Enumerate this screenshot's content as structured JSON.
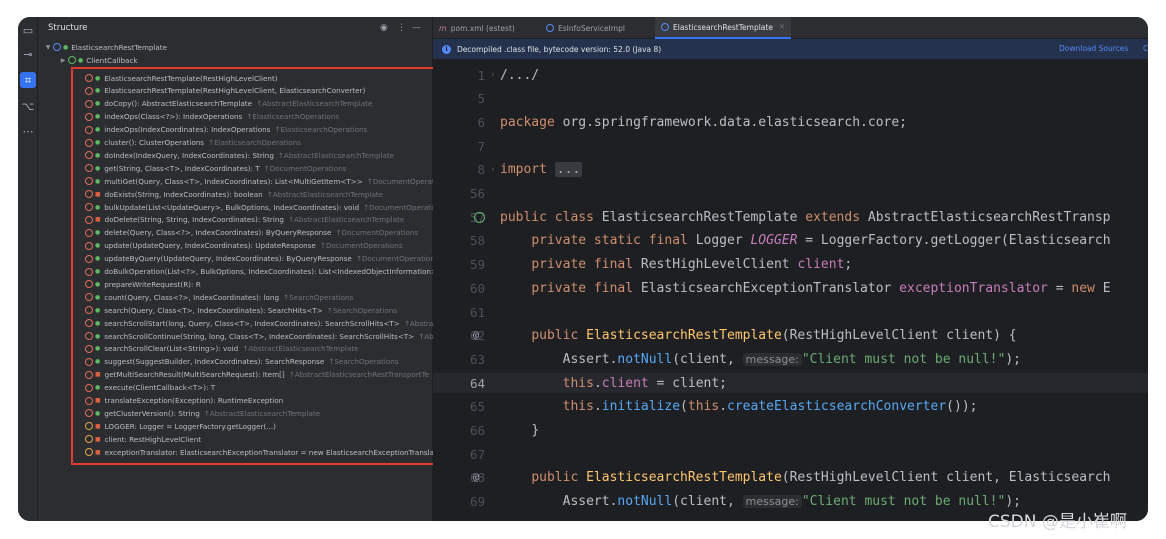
{
  "structure": {
    "title": "Structure",
    "root_label": "ElasticsearchRestTemplate",
    "child_label": "ClientCallback",
    "members": [
      {
        "sig": "ElasticsearchRestTemplate(RestHighLevelClient)",
        "parent": "",
        "kind": "method",
        "vis": "public"
      },
      {
        "sig": "ElasticsearchRestTemplate(RestHighLevelClient, ElasticsearchConverter)",
        "parent": "",
        "kind": "method",
        "vis": "public"
      },
      {
        "sig": "doCopy(): AbstractElasticsearchTemplate",
        "parent": "↑AbstractElasticsearchTemplate",
        "kind": "method",
        "vis": "public"
      },
      {
        "sig": "indexOps(Class<?>): IndexOperations",
        "parent": "↑ElasticsearchOperations",
        "kind": "method",
        "vis": "public"
      },
      {
        "sig": "indexOps(IndexCoordinates): IndexOperations",
        "parent": "↑ElasticsearchOperations",
        "kind": "method",
        "vis": "public"
      },
      {
        "sig": "cluster(): ClusterOperations",
        "parent": "↑ElasticsearchOperations",
        "kind": "method",
        "vis": "public"
      },
      {
        "sig": "doIndex(IndexQuery, IndexCoordinates): String",
        "parent": "↑AbstractElasticsearchTemplate",
        "kind": "method",
        "vis": "public"
      },
      {
        "sig": "get(String, Class<T>, IndexCoordinates): T",
        "parent": "↑DocumentOperations",
        "kind": "method",
        "vis": "public"
      },
      {
        "sig": "multiGet(Query, Class<T>, IndexCoordinates): List<MultiGetItem<T>>",
        "parent": "↑DocumentOperatio",
        "kind": "method",
        "vis": "public"
      },
      {
        "sig": "doExists(String, IndexCoordinates): boolean",
        "parent": "↑AbstractElasticsearchTemplate",
        "kind": "method",
        "vis": "protected"
      },
      {
        "sig": "bulkUpdate(List<UpdateQuery>, BulkOptions, IndexCoordinates): void",
        "parent": "↑DocumentOperati",
        "kind": "method",
        "vis": "public"
      },
      {
        "sig": "doDelete(String, String, IndexCoordinates): String",
        "parent": "↑AbstractElasticsearchTemplate",
        "kind": "method",
        "vis": "protected"
      },
      {
        "sig": "delete(Query, Class<?>, IndexCoordinates): ByQueryResponse",
        "parent": "↑DocumentOperations",
        "kind": "method",
        "vis": "public"
      },
      {
        "sig": "update(UpdateQuery, IndexCoordinates): UpdateResponse",
        "parent": "↑DocumentOperations",
        "kind": "method",
        "vis": "public"
      },
      {
        "sig": "updateByQuery(UpdateQuery, IndexCoordinates): ByQueryResponse",
        "parent": "↑DocumentOperation",
        "kind": "method",
        "vis": "public"
      },
      {
        "sig": "doBulkOperation(List<?>, BulkOptions, IndexCoordinates): List<IndexedObjectInformation>",
        "parent": "",
        "kind": "method",
        "vis": "public"
      },
      {
        "sig": "prepareWriteRequest(R): R",
        "parent": "",
        "kind": "method",
        "vis": "public"
      },
      {
        "sig": "count(Query, Class<?>, IndexCoordinates): long",
        "parent": "↑SearchOperations",
        "kind": "method",
        "vis": "public"
      },
      {
        "sig": "search(Query, Class<T>, IndexCoordinates): SearchHits<T>",
        "parent": "↑SearchOperations",
        "kind": "method",
        "vis": "public"
      },
      {
        "sig": "searchScrollStart(long, Query, Class<T>, IndexCoordinates): SearchScrollHits<T>",
        "parent": "↑Abstra",
        "kind": "method",
        "vis": "public"
      },
      {
        "sig": "searchScrollContinue(String, long, Class<T>, IndexCoordinates): SearchScrollHits<T>",
        "parent": "↑Ab",
        "kind": "method",
        "vis": "public"
      },
      {
        "sig": "searchScrollClear(List<String>): void",
        "parent": "↑AbstractElasticsearchTemplate",
        "kind": "method",
        "vis": "public"
      },
      {
        "sig": "suggest(SuggestBuilder, IndexCoordinates): SearchResponse",
        "parent": "↑SearchOperations",
        "kind": "method",
        "vis": "public"
      },
      {
        "sig": "getMultiSearchResult(MultiSearchRequest): Item[]",
        "parent": "↑AbstractElasticsearchRestTransportTe",
        "kind": "method",
        "vis": "protected"
      },
      {
        "sig": "execute(ClientCallback<T>): T",
        "parent": "",
        "kind": "method",
        "vis": "public"
      },
      {
        "sig": "translateException(Exception): RuntimeException",
        "parent": "",
        "kind": "method",
        "vis": "private"
      },
      {
        "sig": "getClusterVersion(): String",
        "parent": "↑AbstractElasticsearchTemplate",
        "kind": "method",
        "vis": "public"
      },
      {
        "sig": "LOGGER: Logger = LoggerFactory.getLogger(...)",
        "parent": "",
        "kind": "field",
        "vis": "private"
      },
      {
        "sig": "client: RestHighLevelClient",
        "parent": "",
        "kind": "field",
        "vis": "private"
      },
      {
        "sig": "exceptionTranslator: ElasticsearchExceptionTranslator = new ElasticsearchExceptionTransla",
        "parent": "",
        "kind": "field",
        "vis": "private"
      }
    ]
  },
  "tabs": [
    {
      "label": "pom.xml (estest)",
      "icon": "m"
    },
    {
      "label": "EsInfoServiceImpl",
      "icon": "class"
    },
    {
      "label": "ElasticsearchRestTemplate",
      "icon": "class",
      "active": true
    }
  ],
  "banner": {
    "text": "Decompiled .class file, bytecode version: 52.0 (Java 8)",
    "download": "Download Sources",
    "choose": "C"
  },
  "code": {
    "lines": [
      {
        "n": "1",
        "kind": "fold-comment",
        "text": "/.../"
      },
      {
        "n": "5",
        "kind": "blank"
      },
      {
        "n": "6",
        "kind": "package",
        "kw": "package",
        "rest": "org.springframework.data.elasticsearch.core;"
      },
      {
        "n": "7",
        "kind": "blank"
      },
      {
        "n": "8",
        "kind": "import",
        "kw": "import",
        "fold": "..."
      },
      {
        "n": "56",
        "kind": "blank"
      },
      {
        "n": "57",
        "kind": "classdecl",
        "p1": "public class ",
        "name": "ElasticsearchRestTemplate ",
        "p2": "extends ",
        "rest": "AbstractElasticsearchRestTransp"
      },
      {
        "n": "58",
        "kind": "logger",
        "p1": "private static final ",
        "type": "Logger ",
        "fld": "LOGGER",
        "rest": " = LoggerFactory.getLogger(Elasticsearch"
      },
      {
        "n": "59",
        "kind": "field",
        "p1": "private final ",
        "type": "RestHighLevelClient ",
        "fld": "client",
        "rest": ";"
      },
      {
        "n": "60",
        "kind": "field2",
        "p1": "private final ",
        "type": "ElasticsearchExceptionTranslator ",
        "fld": "exceptionTranslator",
        "rest": " = ",
        "kw2": "new ",
        "tail": "E"
      },
      {
        "n": "61",
        "kind": "blank"
      },
      {
        "n": "62",
        "kind": "ctor",
        "p1": "public ",
        "name": "ElasticsearchRestTemplate",
        "rest": "(RestHighLevelClient client) {"
      },
      {
        "n": "63",
        "kind": "assert",
        "call": "Assert.",
        "fn": "notNull",
        "args": "(client, ",
        "hint": "message:",
        "str": "\"Client must not be null!\"",
        "end": ");"
      },
      {
        "n": "64",
        "kind": "assign",
        "kw": "this",
        "dot": ".",
        "fld": "client",
        "rest": " = client;",
        "current": true
      },
      {
        "n": "65",
        "kind": "init",
        "kw": "this",
        "mid": ".",
        "fn": "initialize",
        "p": "(",
        "kw2": "this",
        "mid2": ".",
        "fn2": "createElasticsearchConverter",
        "end": "());"
      },
      {
        "n": "66",
        "kind": "close",
        "text": "}"
      },
      {
        "n": "67",
        "kind": "blank"
      },
      {
        "n": "68",
        "kind": "ctor2",
        "p1": "public ",
        "name": "ElasticsearchRestTemplate",
        "rest": "(RestHighLevelClient client, Elasticsearch"
      },
      {
        "n": "69",
        "kind": "assert2",
        "call": "Assert.",
        "fn": "notNull",
        "args": "(client, ",
        "hint": "message:",
        "str": "\"Client must not be null!\"",
        "end": ");"
      }
    ]
  },
  "watermark": "CSDN @是小崔啊",
  "colors": {
    "highlight_border": "#e33a2f",
    "accent": "#3574f0",
    "editor_bg": "#1e1f22"
  }
}
